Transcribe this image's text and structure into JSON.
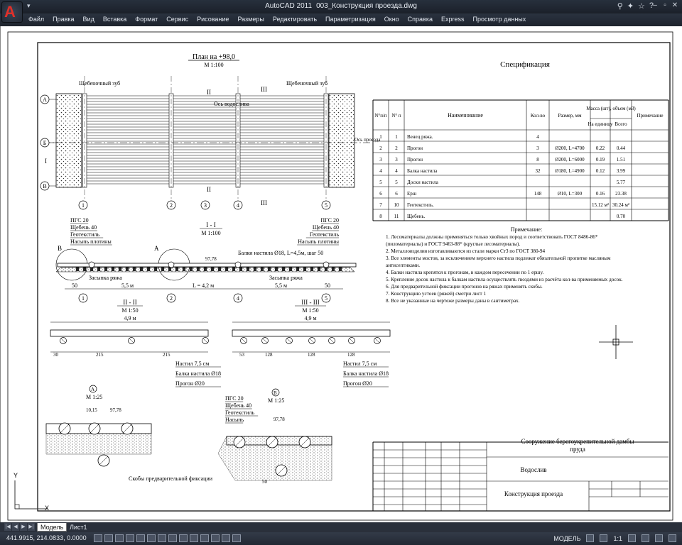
{
  "app": {
    "title_app": "AutoCAD 2011",
    "title_file": "003_Конструкция проезда.dwg",
    "toolbar_icons": [
      "binoculars-icon",
      "wrench-icon",
      "star-icon",
      "help-icon"
    ]
  },
  "menu": [
    "Файл",
    "Правка",
    "Вид",
    "Вставка",
    "Формат",
    "Сервис",
    "Рисование",
    "Размеры",
    "Редактировать",
    "Параметризация",
    "Окно",
    "Справка",
    "Express",
    "Просмотр данных"
  ],
  "tabs": {
    "model": "Модель",
    "sheet": "Лист1"
  },
  "status": {
    "coords": "441.9915, 214.0833, 0.0000",
    "mode": "МОДЕЛЬ",
    "scale": "1:1"
  },
  "drawing": {
    "plan_title": "План на +98,0",
    "plan_scale": "М 1:100",
    "axis_label": "Ось водослива",
    "gravel_tooth": "Щебеночный зуб",
    "axis_proezda": "Ось проезда",
    "section_I_title": "I - I",
    "section_I_scale": "М 1:100",
    "section_II_title": "II - II",
    "section_II_scale": "М 1:50",
    "section_III_title": "III - III",
    "section_III_scale": "М 1:50",
    "node_A_title": "А",
    "node_A_scale": "М 1:25",
    "node_B_title": "В",
    "node_B_scale": "М 1:25",
    "layers": [
      "ПГС 20",
      "Щебень 40",
      "Геотекстиль",
      "Насыпь плотины"
    ],
    "layers_short": [
      "ПГС 20",
      "Щебень 40",
      "Геотекстиль",
      "Насыпь"
    ],
    "beams_note": "Балки настила Ø18, L=4,5м, шаг 50",
    "backfill": "Засыпка ряжа",
    "dim_L": "L = 4,2 м",
    "dim_55": "5,5 м",
    "dim_50": "50",
    "elev": "97,78",
    "width_49": "4,9 м",
    "dims_II": [
      "30",
      "215",
      "215"
    ],
    "dims_III": [
      "53",
      "128",
      "128",
      "128"
    ],
    "callouts": [
      "Настил 7,5 см",
      "Балка настила Ø18",
      "Прогон Ø20"
    ],
    "node_A_dims": [
      "10,15"
    ],
    "staples_note": "Скобы предварительной фиксации",
    "plan_axes_letters": [
      "А",
      "Б",
      "В"
    ],
    "plan_axes_numbers": [
      "1",
      "2",
      "3",
      "4",
      "5"
    ],
    "section_marks": [
      "I",
      "II",
      "III"
    ]
  },
  "spec": {
    "title": "Спецификация",
    "headers": [
      "N°п/п",
      "N° п",
      "Наименование",
      "Кол-во",
      "Размер, мм",
      "Масса (шт), объем (м3)",
      "Примечание"
    ],
    "sub_headers": [
      "На единицу",
      "Всего"
    ],
    "rows": [
      [
        "1",
        "1",
        "Венец ряжа.",
        "4",
        "",
        "",
        "",
        ""
      ],
      [
        "2",
        "2",
        "Прогон",
        "3",
        "Ø200, L=4700",
        "0.22",
        "0.44",
        ""
      ],
      [
        "3",
        "3",
        "Прогон",
        "8",
        "Ø200, L=6000",
        "0.19",
        "1.51",
        ""
      ],
      [
        "4",
        "4",
        "Балка настила",
        "32",
        "Ø180, L=4900",
        "0.12",
        "3.99",
        ""
      ],
      [
        "5",
        "5",
        "Доски настила",
        "",
        "",
        "",
        "5.77",
        ""
      ],
      [
        "6",
        "6",
        "Ерш",
        "148",
        "Ø10, L=300",
        "0.16",
        "23.38",
        ""
      ],
      [
        "7",
        "10",
        "Геотекстиль.",
        "",
        "",
        "15.12 м²",
        "30.24 м²",
        ""
      ],
      [
        "8",
        "11",
        "Щебень.",
        "",
        "",
        "",
        "0.70",
        ""
      ]
    ]
  },
  "notes": {
    "title": "Примечание:",
    "lines": [
      "1. Лесоматериалы должны применяться только хвойных пород и соответствовать ГОСТ 8486-86*",
      "(пиломатериалы) и ГОСТ 9463-88* (круглые лесоматериалы).",
      "2.  Металлоизделия изготавливаются из стали марки Ст3 по ГОСТ 380-94",
      "3.  Все элементы мостов, за исключением верхнего настила подлежат обязательной пропитке масляным",
      "антисептиками.",
      "4. Балки настила крепятся к прогонам, в каждом пересечении по 1 ершу.",
      "5. Крепление досок настила к балкам настила осуществлять гвоздями из расчёта кол-ва применяемых досок.",
      "6. Для предварительной фиксации прогонов на ряжах применять скобы.",
      "7. Конструкцию устоев (ряжей) смотри лист 1",
      "8. Все не указанные на чертеже размеры даны в сантиметрах."
    ]
  },
  "stamp": {
    "project": "Сооружение берегоукрепительной дамбы пруда",
    "object": "Водослив",
    "sheet_title": "Конструкция проезда"
  },
  "ucs": {
    "x": "X",
    "y": "Y"
  }
}
